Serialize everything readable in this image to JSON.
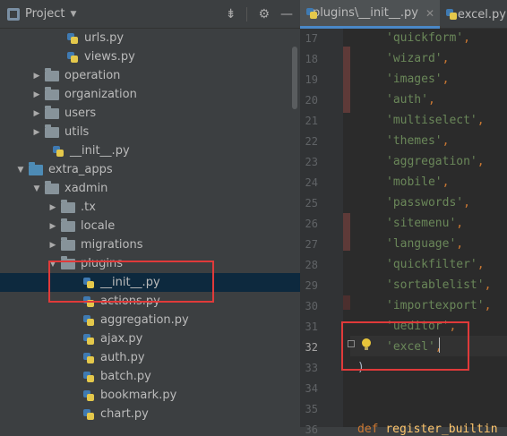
{
  "project_panel": {
    "title": "Project",
    "header_icons": [
      "collapse-all-icon",
      "gear-icon",
      "hide-icon"
    ],
    "tree": [
      {
        "label": "urls.py",
        "kind": "py"
      },
      {
        "label": "views.py",
        "kind": "py"
      },
      {
        "label": "operation",
        "kind": "folder",
        "expanded": false
      },
      {
        "label": "organization",
        "kind": "folder",
        "expanded": false
      },
      {
        "label": "users",
        "kind": "folder",
        "expanded": false
      },
      {
        "label": "utils",
        "kind": "folder",
        "expanded": false
      },
      {
        "label": "__init__.py",
        "kind": "py"
      },
      {
        "label": "extra_apps",
        "kind": "folder",
        "expanded": true
      },
      {
        "label": "xadmin",
        "kind": "folder",
        "expanded": true
      },
      {
        "label": ".tx",
        "kind": "folder",
        "expanded": false
      },
      {
        "label": "locale",
        "kind": "folder",
        "expanded": false
      },
      {
        "label": "migrations",
        "kind": "folder",
        "expanded": false
      },
      {
        "label": "plugins",
        "kind": "folder",
        "expanded": true
      },
      {
        "label": "__init__.py",
        "kind": "py",
        "selected": true
      },
      {
        "label": "actions.py",
        "kind": "py"
      },
      {
        "label": "aggregation.py",
        "kind": "py"
      },
      {
        "label": "ajax.py",
        "kind": "py"
      },
      {
        "label": "auth.py",
        "kind": "py"
      },
      {
        "label": "batch.py",
        "kind": "py"
      },
      {
        "label": "bookmark.py",
        "kind": "py"
      },
      {
        "label": "chart.py",
        "kind": "py"
      }
    ]
  },
  "editor": {
    "tabs": [
      {
        "label": "plugins\\__init__.py",
        "active": true
      },
      {
        "label": "excel.py",
        "active": false
      }
    ],
    "lines": [
      {
        "num": "17",
        "text": "'quickform'",
        "comma": ","
      },
      {
        "num": "18",
        "text": "'wizard'",
        "comma": ","
      },
      {
        "num": "19",
        "text": "'images'",
        "comma": ","
      },
      {
        "num": "20",
        "text": "'auth'",
        "comma": ","
      },
      {
        "num": "21",
        "text": "'multiselect'",
        "comma": ","
      },
      {
        "num": "22",
        "text": "'themes'",
        "comma": ","
      },
      {
        "num": "23",
        "text": "'aggregation'",
        "comma": ","
      },
      {
        "num": "24",
        "text": "'mobile'",
        "comma": ","
      },
      {
        "num": "25",
        "text": "'passwords'",
        "comma": ","
      },
      {
        "num": "26",
        "text": "'sitemenu'",
        "comma": ","
      },
      {
        "num": "27",
        "text": "'language'",
        "comma": ","
      },
      {
        "num": "28",
        "text": "'quickfilter'",
        "comma": ","
      },
      {
        "num": "29",
        "text": "'sortablelist'",
        "comma": ","
      },
      {
        "num": "30",
        "text": "'importexport'",
        "comma": ","
      },
      {
        "num": "31",
        "text": "'ueditor'",
        "comma": ","
      },
      {
        "num": "32",
        "text": "'excel'",
        "comma": ","
      },
      {
        "num": "33",
        "text": ")",
        "comma": ""
      },
      {
        "num": "34",
        "text": "",
        "comma": ""
      },
      {
        "num": "35",
        "text": "",
        "comma": ""
      },
      {
        "num": "36",
        "text": "def register_builtin",
        "comma": ""
      }
    ]
  }
}
